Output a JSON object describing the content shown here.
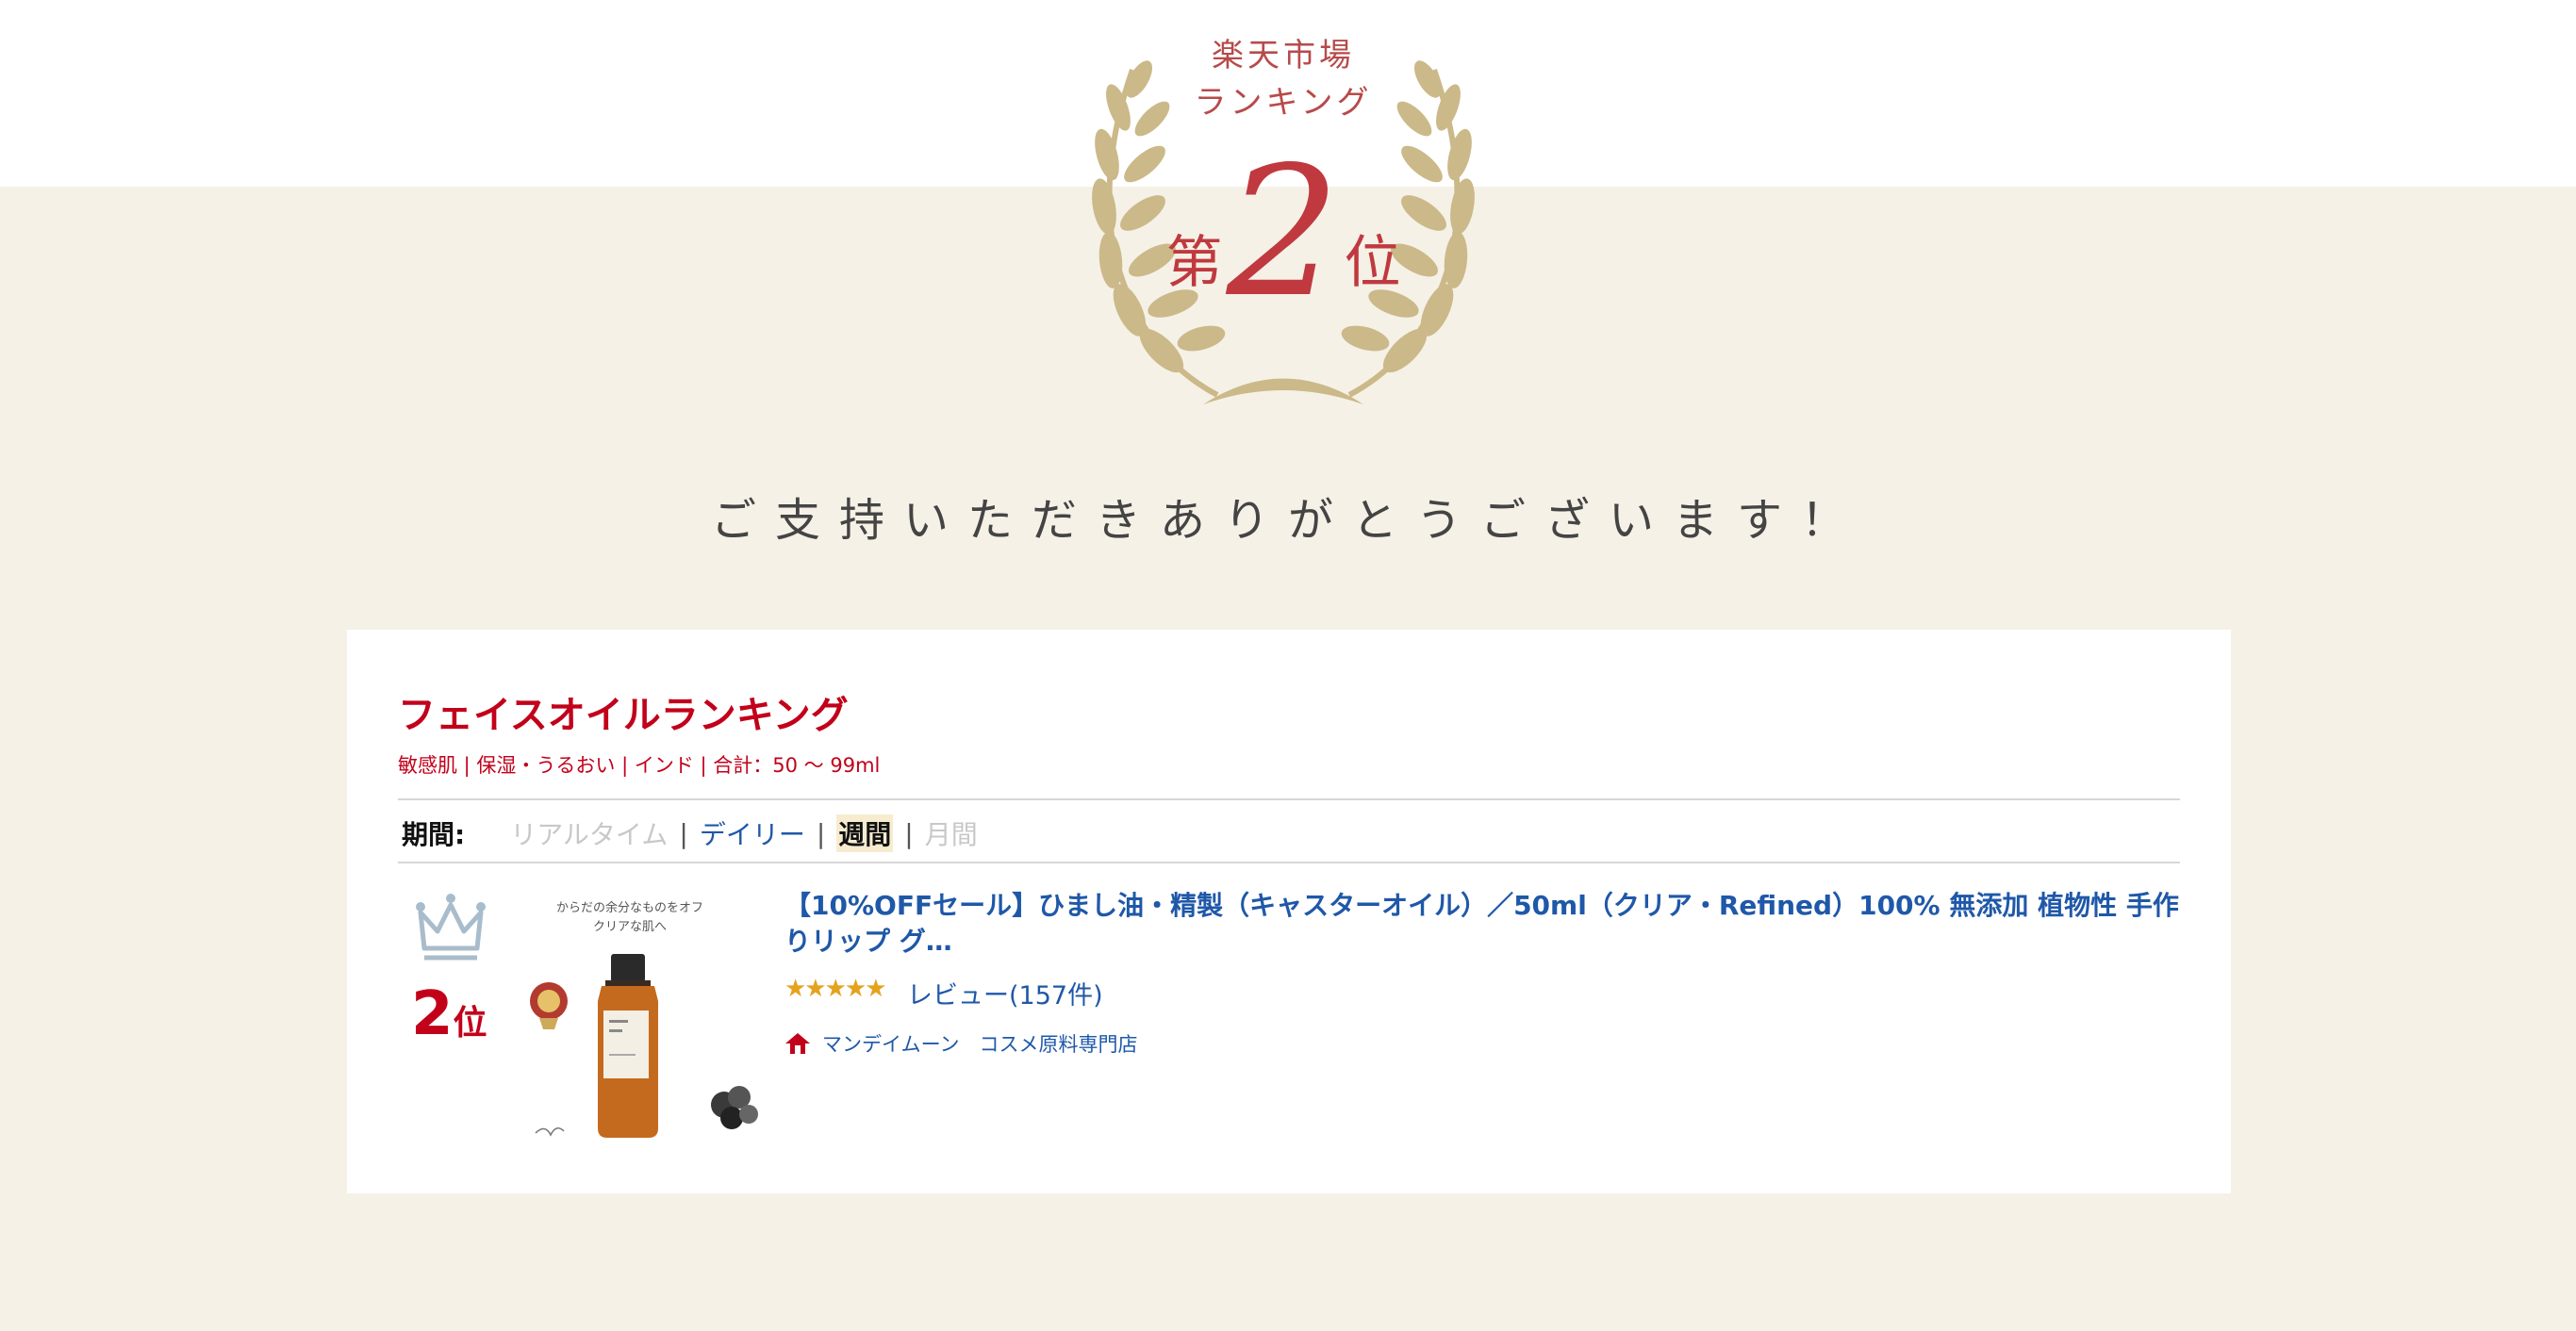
{
  "badge": {
    "store_line1": "楽天市場",
    "store_line2": "ランキング",
    "rank_prefix": "第",
    "rank_number": "2",
    "rank_suffix": "位"
  },
  "thanks_message": "ご支持いただきありがとうございます！",
  "ranking_card": {
    "title": "フェイスオイルランキング",
    "categories": "敏感肌 | 保湿・うるおい | インド | 合計：50 ～ 99ml",
    "period_label": "期間:",
    "periods": [
      "リアルタイム",
      "デイリー",
      "週間",
      "月間"
    ],
    "separator": "|",
    "active_period": "週間",
    "item": {
      "rank_number": "2",
      "rank_unit": "位",
      "image_copy_line1": "からだの余分なものをオフ",
      "image_copy_line2": "クリアな肌へ",
      "title": "【10%OFFセール】ひまし油・精製（キャスターオイル）／50ml（クリア・Refined）100% 無添加 植物性 手作りリップ グ…",
      "rating_stars": 4.5,
      "stars_text": "★★★★★",
      "review_text": "レビュー(157件)",
      "shop_name": "マンデイムーン　コスメ原料専門店"
    }
  },
  "colors": {
    "background": "#f5f1e7",
    "accent_red": "#c2001a",
    "link_blue": "#1f58a8",
    "laurel_gold": "#cbb989",
    "star_orange": "#e5a21d"
  },
  "icons": [
    "laurel-wreath-icon",
    "crown-icon",
    "shop-house-icon",
    "star-rating-icon"
  ]
}
